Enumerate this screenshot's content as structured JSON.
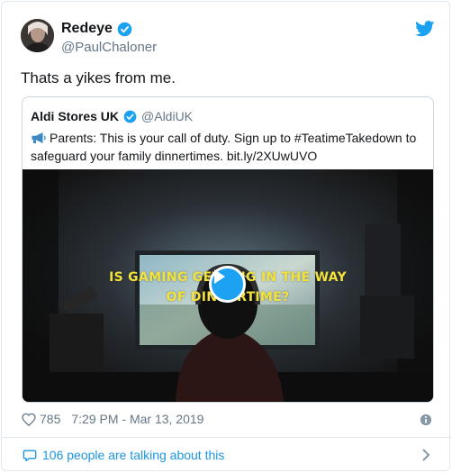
{
  "tweet": {
    "author_name": "Redeye",
    "author_handle": "@PaulChaloner",
    "text": "Thats a yikes from me.",
    "likes": "785",
    "timestamp": "7:29 PM - Mar 13, 2019",
    "conversation_link": "106 people are talking about this"
  },
  "quoted_tweet": {
    "author_name": "Aldi Stores UK",
    "author_handle": "@AldiUK",
    "text": "Parents: This is your call of duty. Sign up to #TeatimeTakedown to safeguard your family dinnertimes. bit.ly/2XUwUVO",
    "video_caption_line1": "IS GAMING GETTING IN THE WAY",
    "video_caption_line2": "OF DINNERTIME?"
  },
  "colors": {
    "accent": "#1da1f2",
    "link": "#1b95e0",
    "muted": "#657786",
    "caption": "#f3e23a"
  },
  "icons": [
    "verified-icon",
    "twitter-bird-icon",
    "megaphone-icon",
    "play-icon",
    "heart-icon",
    "info-icon",
    "speech-bubble-icon",
    "chevron-right-icon"
  ]
}
